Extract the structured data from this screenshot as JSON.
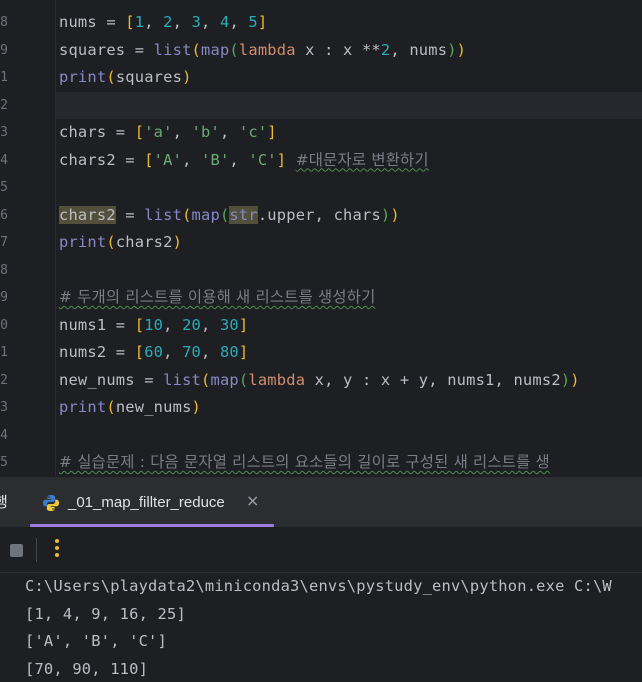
{
  "editor": {
    "line_numbers": [
      "8",
      "9",
      "1",
      "2",
      "3",
      "4",
      "5",
      "6",
      "7",
      "8",
      "9",
      "0",
      "1",
      "2",
      "3",
      "4",
      "5"
    ],
    "lines": [
      {
        "tokens": [
          [
            "var",
            "nums "
          ],
          [
            "op",
            "= "
          ],
          [
            "paren1",
            "["
          ],
          [
            "num",
            "1"
          ],
          [
            "op",
            ", "
          ],
          [
            "num",
            "2"
          ],
          [
            "op",
            ", "
          ],
          [
            "num",
            "3"
          ],
          [
            "op",
            ", "
          ],
          [
            "num",
            "4"
          ],
          [
            "op",
            ", "
          ],
          [
            "num",
            "5"
          ],
          [
            "paren1",
            "]"
          ]
        ]
      },
      {
        "tokens": [
          [
            "var",
            "squares "
          ],
          [
            "op",
            "= "
          ],
          [
            "bi",
            "list"
          ],
          [
            "paren1",
            "("
          ],
          [
            "bi",
            "map"
          ],
          [
            "paren2",
            "("
          ],
          [
            "kw",
            "lambda "
          ],
          [
            "var",
            "x "
          ],
          [
            "op",
            ": "
          ],
          [
            "var",
            "x "
          ],
          [
            "op",
            "**"
          ],
          [
            "num",
            "2"
          ],
          [
            "op",
            ", "
          ],
          [
            "var",
            "nums"
          ],
          [
            "paren2",
            ")"
          ],
          [
            "paren1",
            ")"
          ]
        ]
      },
      {
        "tokens": [
          [
            "bi",
            "print"
          ],
          [
            "paren1",
            "("
          ],
          [
            "var",
            "squares"
          ],
          [
            "paren1",
            ")"
          ]
        ]
      },
      {
        "tokens": [],
        "current": true
      },
      {
        "tokens": [
          [
            "var",
            "chars "
          ],
          [
            "op",
            "= "
          ],
          [
            "paren1",
            "["
          ],
          [
            "str",
            "'a'"
          ],
          [
            "op",
            ", "
          ],
          [
            "str",
            "'b'"
          ],
          [
            "op",
            ", "
          ],
          [
            "str",
            "'c'"
          ],
          [
            "paren1",
            "]"
          ]
        ]
      },
      {
        "tokens": [
          [
            "var",
            "chars2 "
          ],
          [
            "op",
            "= "
          ],
          [
            "paren1",
            "["
          ],
          [
            "str",
            "'A'"
          ],
          [
            "op",
            ", "
          ],
          [
            "str",
            "'B'"
          ],
          [
            "op",
            ", "
          ],
          [
            "str",
            "'C'"
          ],
          [
            "paren1",
            "] "
          ],
          [
            "cmtsq",
            "#대문자로 변환하기"
          ]
        ]
      },
      {
        "tokens": []
      },
      {
        "tokens": [
          [
            "hl",
            "chars2"
          ],
          [
            "op",
            " = "
          ],
          [
            "bi",
            "list"
          ],
          [
            "paren1",
            "("
          ],
          [
            "bi",
            "map"
          ],
          [
            "paren2",
            "("
          ],
          [
            "hl2",
            "str"
          ],
          [
            "op",
            "."
          ],
          [
            "var",
            "upper"
          ],
          [
            "op",
            ", "
          ],
          [
            "var",
            "chars"
          ],
          [
            "paren2",
            ")"
          ],
          [
            "paren1",
            ")"
          ]
        ]
      },
      {
        "tokens": [
          [
            "bi",
            "print"
          ],
          [
            "paren1",
            "("
          ],
          [
            "var",
            "chars2"
          ],
          [
            "paren1",
            ")"
          ]
        ]
      },
      {
        "tokens": []
      },
      {
        "tokens": [
          [
            "cmtsq",
            "# 두개의 리스트를 이용해 새 리스트를 생성하기"
          ]
        ]
      },
      {
        "tokens": [
          [
            "var",
            "nums1 "
          ],
          [
            "op",
            "= "
          ],
          [
            "paren1",
            "["
          ],
          [
            "num",
            "10"
          ],
          [
            "op",
            ", "
          ],
          [
            "num",
            "20"
          ],
          [
            "op",
            ", "
          ],
          [
            "num",
            "30"
          ],
          [
            "paren1",
            "]"
          ]
        ]
      },
      {
        "tokens": [
          [
            "var",
            "nums2 "
          ],
          [
            "op",
            "= "
          ],
          [
            "paren1",
            "["
          ],
          [
            "num",
            "60"
          ],
          [
            "op",
            ", "
          ],
          [
            "num",
            "70"
          ],
          [
            "op",
            ", "
          ],
          [
            "num",
            "80"
          ],
          [
            "paren1",
            "]"
          ]
        ]
      },
      {
        "tokens": [
          [
            "var",
            "new_nums "
          ],
          [
            "op",
            "= "
          ],
          [
            "bi",
            "list"
          ],
          [
            "paren1",
            "("
          ],
          [
            "bi",
            "map"
          ],
          [
            "paren2",
            "("
          ],
          [
            "kw",
            "lambda "
          ],
          [
            "var",
            "x"
          ],
          [
            "op",
            ", "
          ],
          [
            "var",
            "y "
          ],
          [
            "op",
            ": "
          ],
          [
            "var",
            "x "
          ],
          [
            "op",
            "+ "
          ],
          [
            "var",
            "y"
          ],
          [
            "op",
            ", "
          ],
          [
            "var",
            "nums1"
          ],
          [
            "op",
            ", "
          ],
          [
            "var",
            "nums2"
          ],
          [
            "paren2",
            ")"
          ],
          [
            "paren1",
            ")"
          ]
        ]
      },
      {
        "tokens": [
          [
            "bi",
            "print"
          ],
          [
            "paren1",
            "("
          ],
          [
            "var",
            "new_nums"
          ],
          [
            "paren1",
            ")"
          ]
        ]
      },
      {
        "tokens": []
      },
      {
        "tokens": [
          [
            "cmtsq",
            "# 실습문제 : 다음 문자열 리스트의 요소들의 길이로 구성된 새 리스트를 생"
          ]
        ]
      }
    ]
  },
  "tool_window": {
    "left_stub": "행",
    "run_tab_label": "_01_map_fillter_reduce",
    "close_glyph": "×"
  },
  "toolbar": {
    "stop_icon": "stop-icon",
    "more_icon": "more-vertical-icon"
  },
  "console": {
    "lines": [
      "C:\\Users\\playdata2\\miniconda3\\envs\\pystudy_env\\python.exe C:\\W",
      "[1, 4, 9, 16, 25]",
      "['A', 'B', 'C']",
      "[70, 90, 110]"
    ]
  },
  "colors": {
    "keyword": "#cf8e6d",
    "builtin": "#8888c6",
    "number": "#2aacb8",
    "string": "#6aab73",
    "comment": "#7a7e85",
    "tab_accent": "#9f7ee0"
  }
}
